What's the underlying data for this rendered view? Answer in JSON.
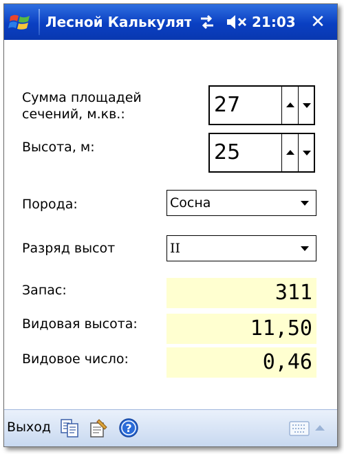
{
  "titlebar": {
    "app_title": "Лесной Калькулятор",
    "clock": "21:03",
    "close_glyph": "✕",
    "icons": [
      "windows-start-icon",
      "connectivity-icon",
      "volume-muted-icon"
    ]
  },
  "form": {
    "basal_area": {
      "label": "Сумма площадей сечений, м.кв.:",
      "value": "27"
    },
    "height": {
      "label": "Высота, м:",
      "value": "25"
    },
    "species": {
      "label": "Порода:",
      "value": "Сосна"
    },
    "height_class": {
      "label": "Разряд высот",
      "value": "II"
    }
  },
  "results": {
    "stock": {
      "label": "Запас:",
      "value": "311"
    },
    "species_height": {
      "label": "Видовая высота:",
      "value": "11,50"
    },
    "form_factor": {
      "label": "Видовое число:",
      "value": "0,46"
    }
  },
  "menubar": {
    "exit_label": "Выход",
    "icons": [
      "copy-icon",
      "settings-icon",
      "help-icon",
      "keyboard-icon",
      "sip-arrow-up-icon"
    ]
  },
  "colors": {
    "titlebar": "#0a3fc2",
    "result_background": "#ffffd0",
    "menubar": "#d6e3f5"
  }
}
